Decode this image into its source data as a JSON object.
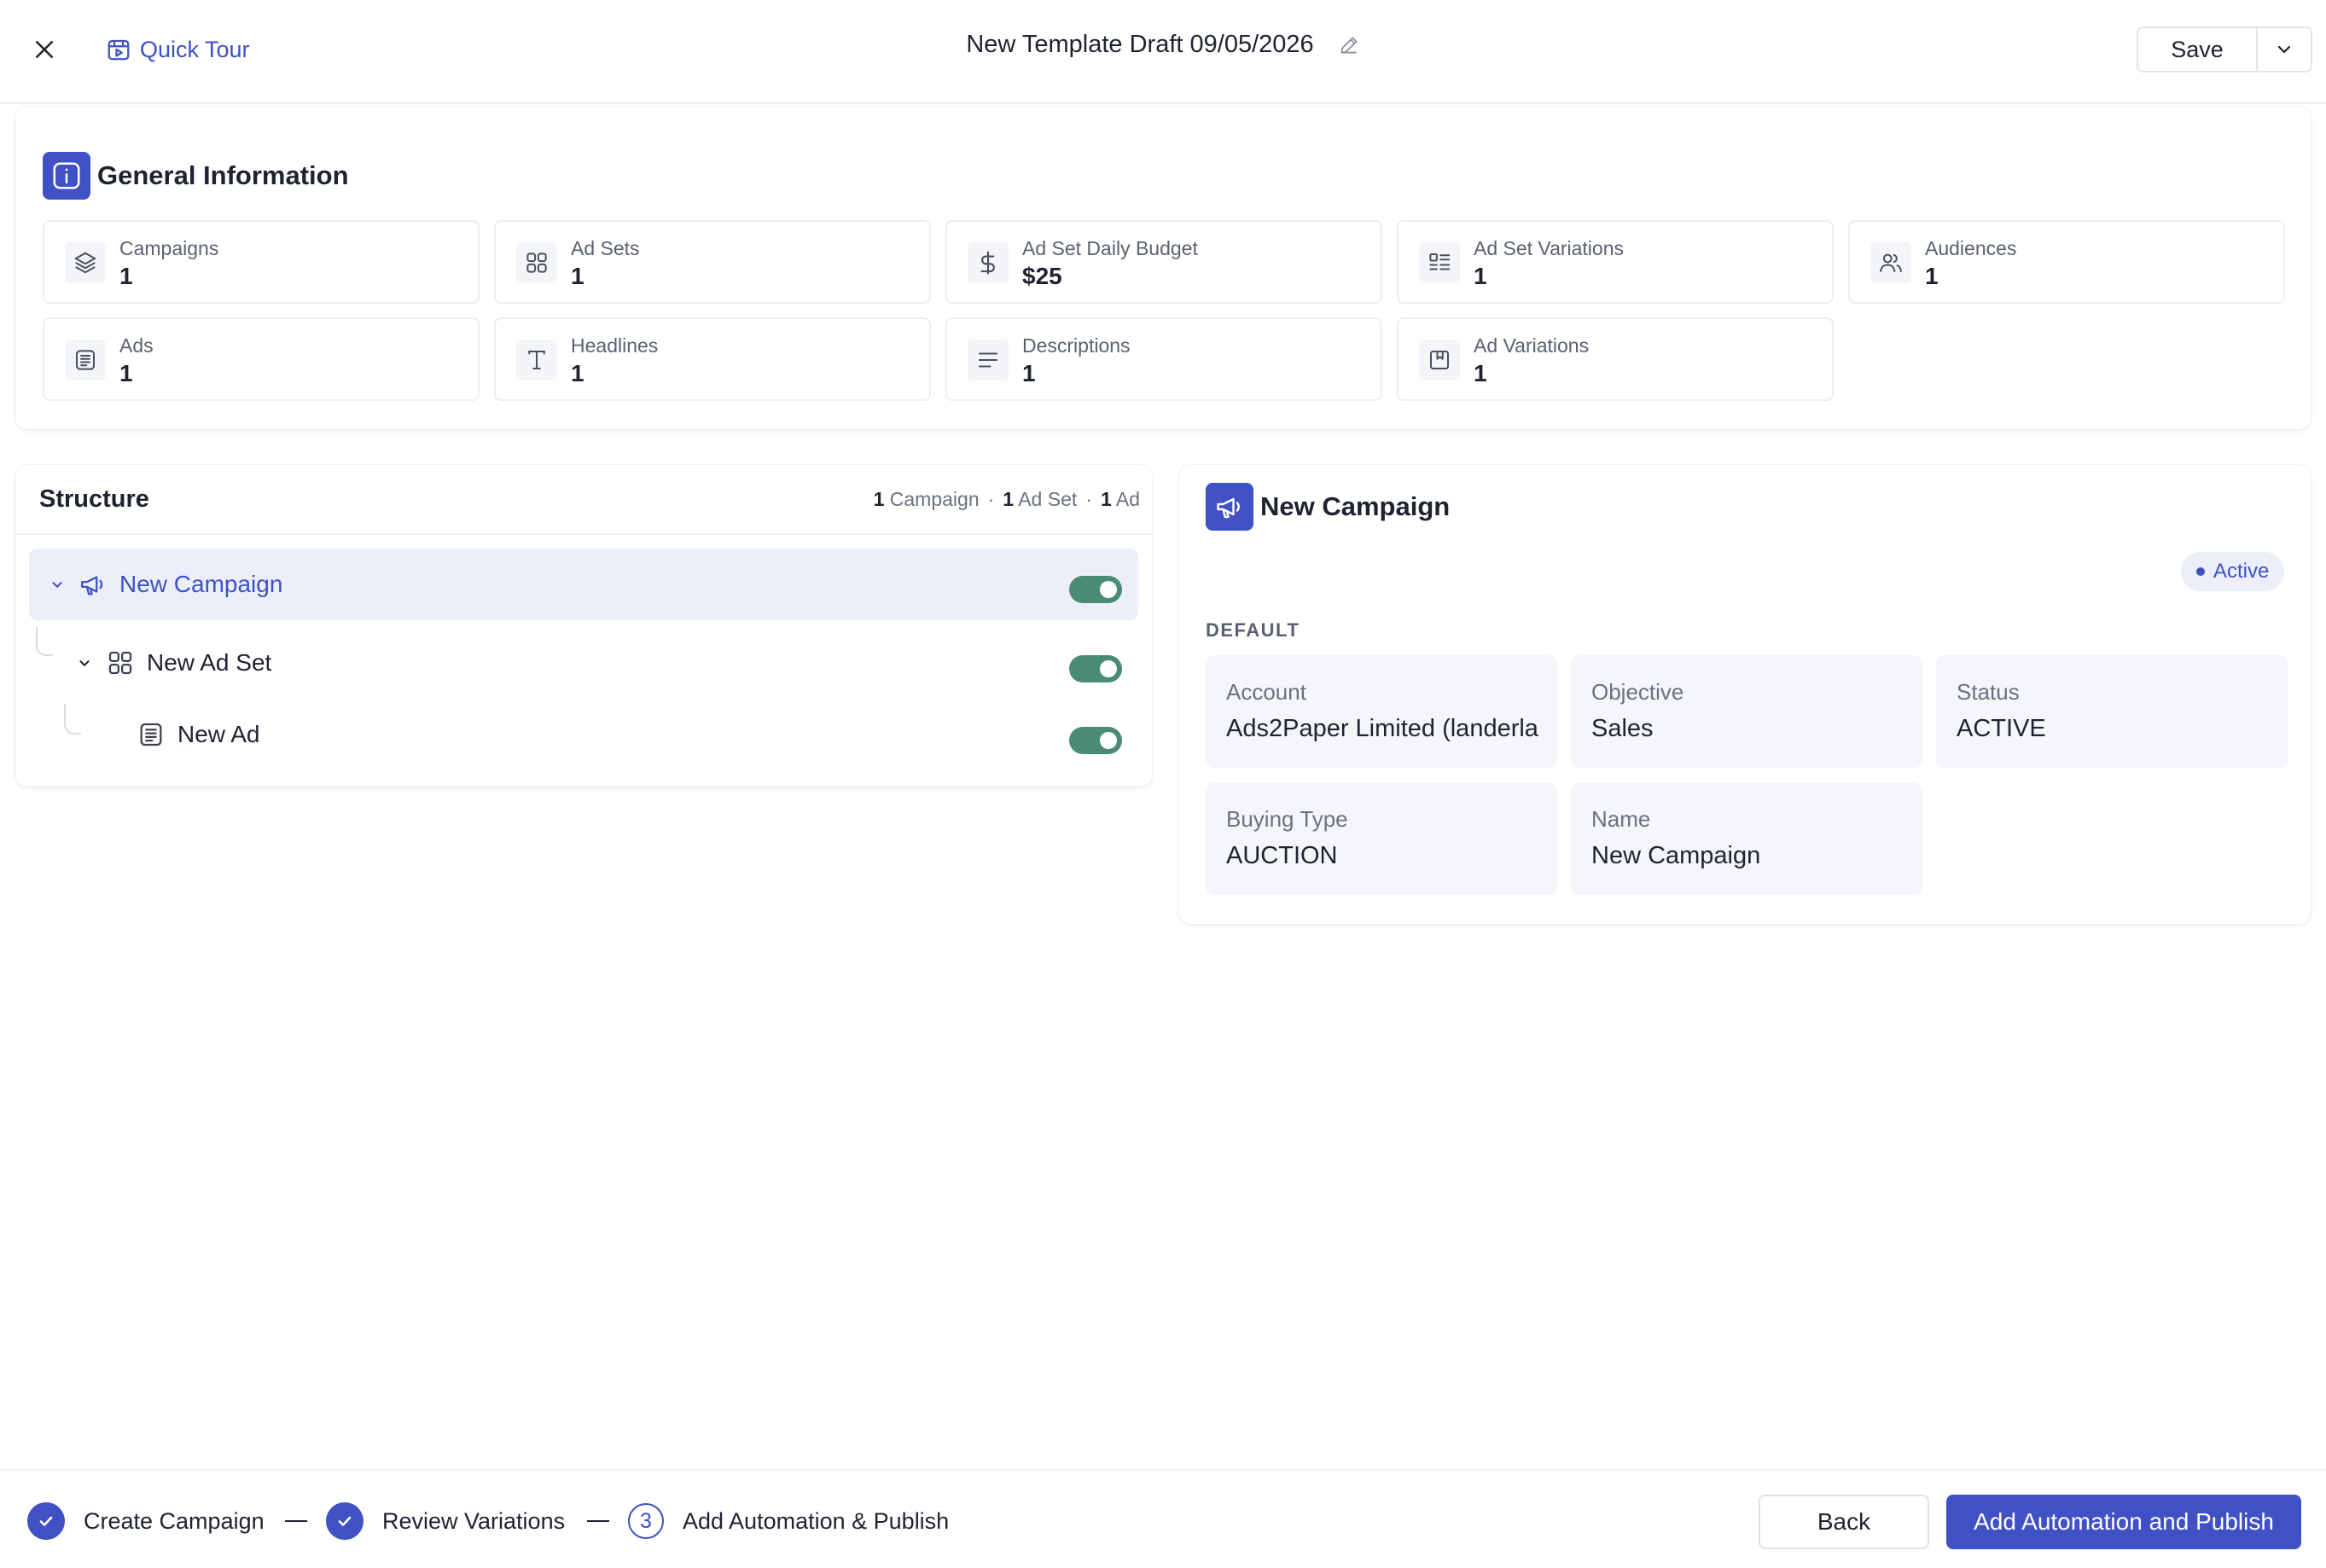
{
  "header": {
    "quick_tour_label": "Quick Tour",
    "title": "New Template Draft 09/05/2026",
    "save_label": "Save"
  },
  "general_info": {
    "title": "General Information",
    "stats": [
      {
        "label": "Campaigns",
        "value": "1",
        "icon": "layers-icon"
      },
      {
        "label": "Ad Sets",
        "value": "1",
        "icon": "grid-icon"
      },
      {
        "label": "Ad Set Daily Budget",
        "value": "$25",
        "icon": "dollar-icon"
      },
      {
        "label": "Ad Set Variations",
        "value": "1",
        "icon": "list-icon"
      },
      {
        "label": "Audiences",
        "value": "1",
        "icon": "users-icon"
      },
      {
        "label": "Ads",
        "value": "1",
        "icon": "ad-icon"
      },
      {
        "label": "Headlines",
        "value": "1",
        "icon": "text-icon"
      },
      {
        "label": "Descriptions",
        "value": "1",
        "icon": "align-left-icon"
      },
      {
        "label": "Ad Variations",
        "value": "1",
        "icon": "bookmark-icon"
      }
    ]
  },
  "structure": {
    "title": "Structure",
    "summary": {
      "campaign_count": "1",
      "campaign_label": "Campaign",
      "adset_count": "1",
      "adset_label": "Ad Set",
      "ad_count": "1",
      "ad_label": "Ad",
      "separator": "·"
    },
    "rows": [
      {
        "label": "New Campaign",
        "enabled": true
      },
      {
        "label": "New Ad Set",
        "enabled": true
      },
      {
        "label": "New Ad",
        "enabled": true
      }
    ]
  },
  "campaign_detail": {
    "title": "New Campaign",
    "status_badge": "Active",
    "section_label": "DEFAULT",
    "fields": [
      {
        "label": "Account",
        "value": "Ads2Paper Limited (landerla"
      },
      {
        "label": "Objective",
        "value": "Sales"
      },
      {
        "label": "Status",
        "value": "ACTIVE"
      },
      {
        "label": "Buying Type",
        "value": "AUCTION"
      },
      {
        "label": "Name",
        "value": "New Campaign"
      }
    ]
  },
  "footer": {
    "steps": [
      {
        "label": "Create Campaign",
        "state": "done"
      },
      {
        "label": "Review Variations",
        "state": "done"
      },
      {
        "label": "Add Automation & Publish",
        "state": "current",
        "number": "3"
      }
    ],
    "back_label": "Back",
    "publish_label": "Add Automation and Publish"
  },
  "colors": {
    "accent": "#3f51c4",
    "toggle_on": "#4a8c73",
    "selected_row": "#eceefa",
    "field_bg": "#f4f6fa"
  }
}
